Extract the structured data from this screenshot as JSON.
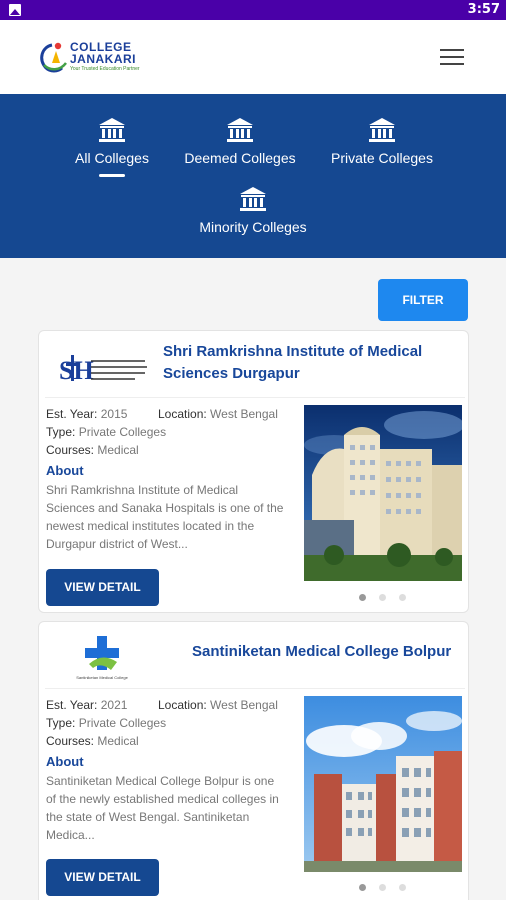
{
  "status_bar": {
    "time": "3:57"
  },
  "app": {
    "logo": {
      "line1": "COLLEGE",
      "line2": "JANAKARI",
      "tagline": "Your Trusted Education Partner"
    }
  },
  "categories": [
    {
      "label": "All Colleges",
      "active": true
    },
    {
      "label": "Deemed Colleges",
      "active": false
    },
    {
      "label": "Private Colleges",
      "active": false
    },
    {
      "label": "Minority Colleges",
      "active": false
    }
  ],
  "filter_label": "FILTER",
  "field_labels": {
    "est_year": "Est. Year:",
    "location": "Location:",
    "type": "Type:",
    "courses": "Courses:",
    "about": "About",
    "view_detail": "VIEW DETAIL"
  },
  "colleges": [
    {
      "name": "Shri Ramkrishna Institute of Medical Sciences Durgapur",
      "logo_text": "SHRI RAMKRISHNA INSTITUTE OF MEDICAL SCIENCES & SANAKA HOSPITALS",
      "est_year": "2015",
      "location": "West Bengal",
      "type": "Private Colleges",
      "courses": "Medical",
      "about": "Shri Ramkrishna Institute of Medical Sciences and Sanaka Hospitals is one of the newest medical institutes located in the Durgapur district of West...",
      "carousel_index": 0
    },
    {
      "name": "Santiniketan Medical College Bolpur",
      "logo_text": "Santiniketan Medical College",
      "est_year": "2021",
      "location": "West Bengal",
      "type": "Private Colleges",
      "courses": "Medical",
      "about": "Santiniketan Medical College Bolpur  is one of the newly established medical colleges in the state of West Bengal. Santiniketan Medica...",
      "carousel_index": 0
    }
  ],
  "colors": {
    "status_bar": "#4a00a8",
    "category_bar": "#154891",
    "filter_button": "#1e88ef",
    "title_blue": "#18479a"
  }
}
